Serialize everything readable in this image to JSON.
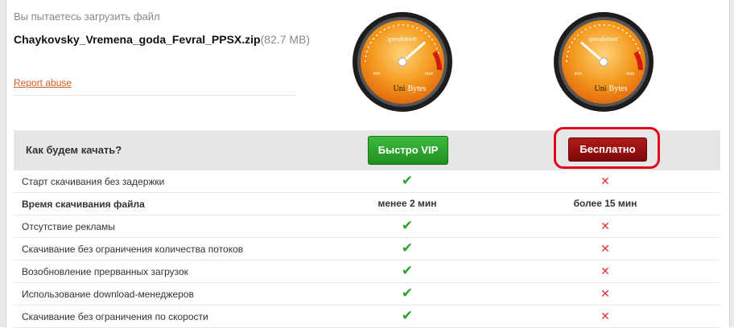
{
  "intro_text": "Вы пытаетесь загрузить файл",
  "file": {
    "name": "Chaykovsky_Vremena_goda_Fevral_PPSX.zip",
    "size": "(82.7 MB)"
  },
  "report_abuse": "Report abuse",
  "gauges": [
    {
      "label": "speedometr",
      "min": "min",
      "max": "max",
      "brand_uni": "Uni",
      "brand_bytes": "Bytes",
      "needle_level": 0.85
    },
    {
      "label": "speedometr",
      "min": "min",
      "max": "max",
      "brand_uni": "Uni",
      "brand_bytes": "Bytes",
      "needle_level": 0.15
    }
  ],
  "table": {
    "question": "Как будем качать?",
    "vip_button": "Быстро VIP",
    "free_button": "Бесплатно",
    "rows": [
      {
        "label": "Старт скачивания без задержки",
        "vip": "check",
        "free": "cross",
        "bold": false
      },
      {
        "label": "Время скачивания файла",
        "vip": "менее 2 мин",
        "free": "более 15 мин",
        "bold": true
      },
      {
        "label": "Отсутствие рекламы",
        "vip": "check",
        "free": "cross",
        "bold": false
      },
      {
        "label": "Скачивание без ограничения количества потоков",
        "vip": "check",
        "free": "cross",
        "bold": false
      },
      {
        "label": "Возобновление прерванных загрузок",
        "vip": "check",
        "free": "cross",
        "bold": false
      },
      {
        "label": "Использование download-менеджеров",
        "vip": "check",
        "free": "cross",
        "bold": false
      },
      {
        "label": "Скачивание без ограничения по скорости",
        "vip": "check",
        "free": "cross",
        "bold": false
      }
    ]
  },
  "colors": {
    "vip_green": "#1f8f1f",
    "free_red": "#7e0808",
    "highlight_red": "#e3001b",
    "gauge_orange": "#f39a1e"
  }
}
